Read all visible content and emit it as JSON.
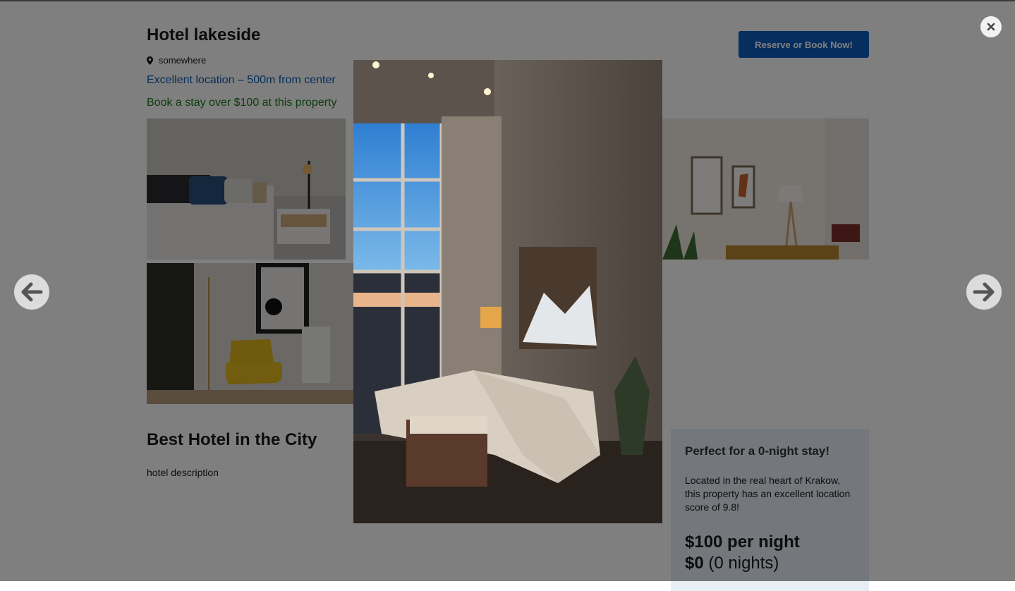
{
  "hotel": {
    "name": "Hotel lakeside",
    "location": "somewhere",
    "highlight": "Excellent location – 500m from center",
    "promo": "Book a stay over $100 at this property",
    "reserve_label": "Reserve or Book Now!"
  },
  "about": {
    "heading": "Best Hotel in the City",
    "description": "hotel description"
  },
  "booking_card": {
    "heading": "Perfect for a 0-night stay!",
    "text": "Located in the real heart of Krakow, this property has an excellent location score of 9.8!",
    "price_per_night": "$100 per night",
    "total_amount": "$0",
    "total_nights": "(0 nights)"
  },
  "lightbox": {
    "icons": [
      "close-icon",
      "arrow-left-icon",
      "arrow-right-icon"
    ]
  },
  "colors": {
    "accent": "#0c5dbf",
    "highlight_text": "#0d5bb5",
    "promo_text": "#1a7a1a",
    "card_bg": "#e8eef6",
    "overlay": "rgba(0,0,0,0.5)"
  }
}
